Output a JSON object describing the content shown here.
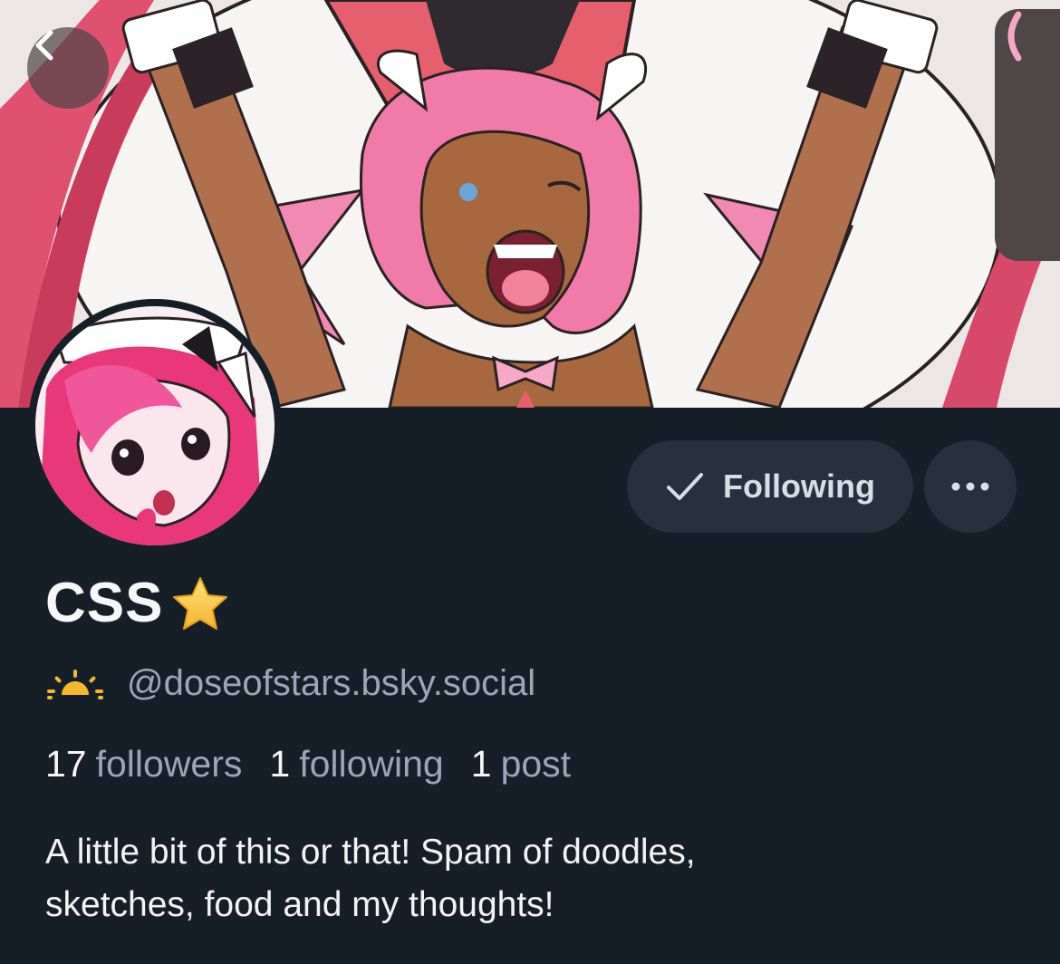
{
  "profile": {
    "display_name": "CSS",
    "name_emoji": "⭐",
    "handle": "@doseofstars.bsky.social",
    "status_icon": "sunrise-icon",
    "follow_button_label": "Following",
    "more_icon": "ellipsis-icon",
    "stats": {
      "followers_count": "17",
      "followers_label": "followers",
      "following_count": "1",
      "following_label": "following",
      "posts_count": "1",
      "posts_label": "post"
    },
    "bio_line1": "A little bit of this or that! Spam of doodles,",
    "bio_line2": "sketches, food and my thoughts!"
  },
  "navigation": {
    "back_icon": "chevron-left-icon",
    "side_tab_icon": "chevron-left-icon"
  },
  "colors": {
    "background": "#161e27",
    "button_bg": "#26313d",
    "muted_text": "#9aa7b5",
    "accent_pink": "#f07aa8",
    "star": "#f5c542"
  }
}
